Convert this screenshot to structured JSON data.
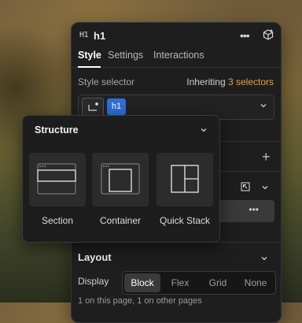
{
  "header": {
    "tag_badge": "H1",
    "element_name": "h1",
    "more_label": "•••"
  },
  "tabs": [
    {
      "label": "Style",
      "active": true
    },
    {
      "label": "Settings",
      "active": false
    },
    {
      "label": "Interactions",
      "active": false
    }
  ],
  "style_selector": {
    "label": "Style selector",
    "inheriting_prefix": "Inheriting",
    "inheriting_count": "3 selectors",
    "chip": "h1"
  },
  "row_actions": {
    "plus": "+",
    "more": "•••"
  },
  "structure_popover": {
    "title": "Structure",
    "items": [
      {
        "label": "Section",
        "icon": "section-layout-icon"
      },
      {
        "label": "Container",
        "icon": "container-layout-icon"
      },
      {
        "label": "Quick Stack",
        "icon": "quick-stack-layout-icon"
      }
    ]
  },
  "layout": {
    "title": "Layout",
    "display_label": "Display",
    "display_options": [
      "Block",
      "Flex",
      "Grid",
      "None"
    ],
    "display_selected": "Block",
    "footnote": "1 on this page, 1 on other pages"
  },
  "colors": {
    "accent_blue": "#2f6fd6",
    "inherit_orange": "#e0a34a",
    "panel_bg": "#1e1e1e"
  }
}
